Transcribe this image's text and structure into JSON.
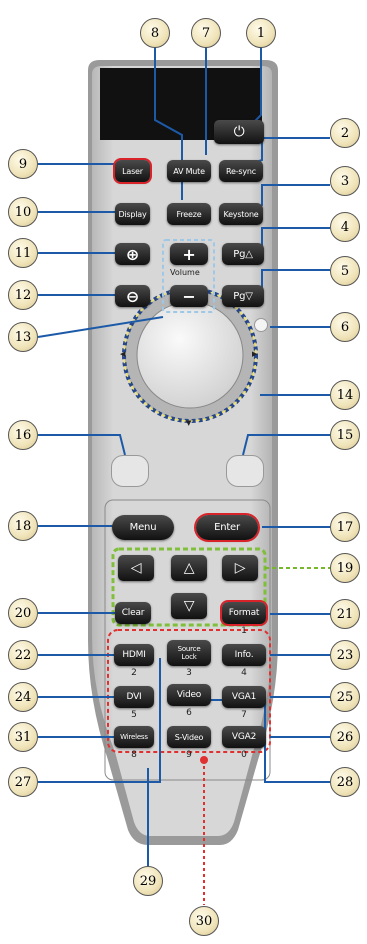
{
  "buttons": {
    "power": "⏻",
    "laser": "Laser",
    "av_mute": "AV Mute",
    "resync": "Re-sync",
    "display": "Display",
    "freeze": "Freeze",
    "keystone": "Keystone",
    "zoom_in": "⊕",
    "zoom_out": "⊖",
    "vol_plus": "+",
    "vol_minus": "−",
    "volume_label": "Volume",
    "pg_up": "Pg△",
    "pg_down": "Pg▽",
    "menu": "Menu",
    "enter": "Enter",
    "left": "◁",
    "up": "△",
    "right": "▷",
    "down": "▽",
    "clear": "Clear",
    "format": "Format",
    "hdmi": "HDMI",
    "source_lock_1": "Source",
    "source_lock_2": "Lock",
    "info": "Info.",
    "dvi": "DVI",
    "video": "Video",
    "vga1": "VGA1",
    "wireless": "Wireless",
    "svideo": "S-Video",
    "vga2": "VGA2"
  },
  "digits": {
    "d1": "1",
    "d2": "2",
    "d3": "3",
    "d4": "4",
    "d5": "5",
    "d6": "6",
    "d7": "7",
    "d8": "8",
    "d9": "9",
    "d0": "0"
  },
  "callouts": {
    "c1": "1",
    "c2": "2",
    "c3": "3",
    "c4": "4",
    "c5": "5",
    "c6": "6",
    "c7": "7",
    "c8": "8",
    "c9": "9",
    "c10": "10",
    "c11": "11",
    "c12": "12",
    "c13": "13",
    "c14": "14",
    "c15": "15",
    "c16": "16",
    "c17": "17",
    "c18": "18",
    "c19": "19",
    "c20": "20",
    "c21": "21",
    "c22": "22",
    "c23": "23",
    "c24": "24",
    "c25": "25",
    "c26": "26",
    "c27": "27",
    "c28": "28",
    "c29": "29",
    "c30": "30",
    "c31": "31"
  },
  "colors": {
    "highlight_red": "#d9232a",
    "leader_blue": "#1c5aa8",
    "leader_green": "#76b82a",
    "remote_body": "#c9c9c9"
  }
}
